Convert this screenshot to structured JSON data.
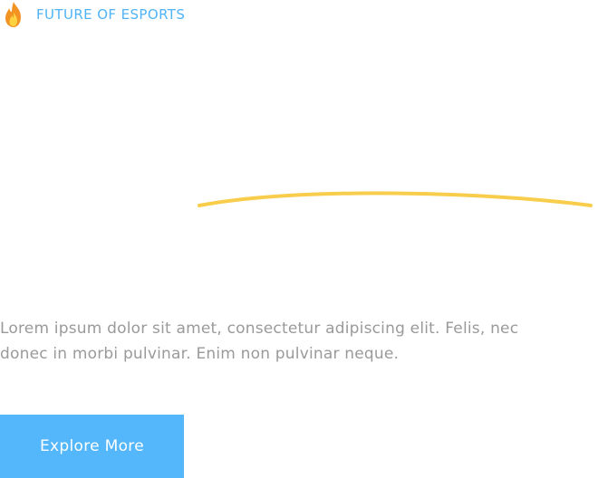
{
  "eyebrow": {
    "icon": "fire-icon",
    "text": "FUTURE OF ESPORTS",
    "color": "#4fb3f6"
  },
  "headline": {
    "underline_color": "#f8cd4b"
  },
  "description": "Lorem ipsum dolor sit amet, consectetur adipiscing elit. Felis, nec donec in morbi pulvinar. Enim non pulvinar neque.",
  "cta": {
    "label": "Explore More",
    "background": "#55b7fb"
  }
}
